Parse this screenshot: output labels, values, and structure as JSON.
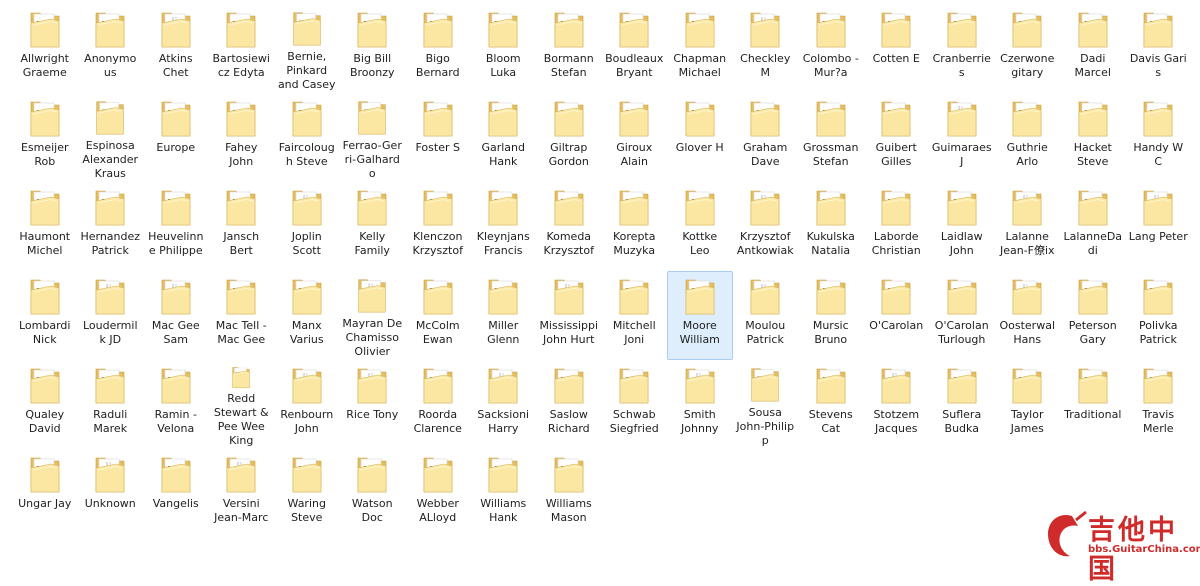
{
  "folders": [
    "Allwright\nGraeme",
    "Anonymo\nus",
    "Atkins\nChet",
    "Bartosiewi\ncz Edyta",
    "Bernie,\nPinkard\nand Casey",
    "Big Bill\nBroonzy",
    "Bigo\nBernard",
    "Bloom\nLuka",
    "Bormann\nStefan",
    "Boudleaux\nBryant",
    "Chapman\nMichael",
    "Checkley\nM",
    "Colombo -\nMur?a",
    "Cotten E",
    "Cranberrie\ns",
    "Czerwone\ngitary",
    "Dadi\nMarcel",
    "Davis Garis",
    "Esmeijer\nRob",
    "Espinosa\nAlexander\nKraus",
    "Europe",
    "Fahey\nJohn",
    "Faircoloug\nh Steve",
    "Ferrao-Ger\nri-Galhard\no",
    "Foster S",
    "Garland\nHank",
    "Giltrap\nGordon",
    "Giroux\nAlain",
    "Glover H",
    "Graham\nDave",
    "Grossman\nStefan",
    "Guibert\nGilles",
    "Guimaraes\nJ",
    "Guthrie\nArlo",
    "Hacket\nSteve",
    "Handy W\nC",
    "Haumont\nMichel",
    "Hernandez\nPatrick",
    "Heuvelinn\ne Philippe",
    "Jansch\nBert",
    "Joplin\nScott",
    "Kelly\nFamily",
    "Klenczon\nKrzysztof",
    "Kleynjans\nFrancis",
    "Komeda\nKrzysztof",
    "Korepta\nMuzyka",
    "Kottke\nLeo",
    "Krzysztof\nAntkowiak",
    "Kukulska\nNatalia",
    "Laborde\nChristian",
    "Laidlaw\nJohn",
    "Lalanne\nJean-F僚ix",
    "LalanneDa\ndi",
    "Lang Peter",
    "Lombardi\nNick",
    "Loudermil\nk JD",
    "Mac Gee\nSam",
    "Mac Tell -\nMac Gee",
    "Manx\nVarius",
    "Mayran De\nChamisso\nOlivier",
    "McColm\nEwan",
    "Miller\nGlenn",
    "Mississippi\nJohn Hurt",
    "Mitchell\nJoni",
    "Moore\nWilliam",
    "Moulou\nPatrick",
    "Mursic\nBruno",
    "O'Carolan",
    "O'Carolan\nTurlough",
    "Oosterwal\nHans",
    "Peterson\nGary",
    "Polivka\nPatrick",
    "Qualey\nDavid",
    "Raduli\nMarek",
    "Ramin -\nVelona",
    "Redd\nStewart &\nPee Wee\nKing",
    "Renbourn\nJohn",
    "Rice Tony",
    "Roorda\nClarence",
    "Sacksioni\nHarry",
    "Saslow\nRichard",
    "Schwab\nSiegfried",
    "Smith\nJohnny",
    "Sousa\nJohn-Philip\np",
    "Stevens\nCat",
    "Stotzem\nJacques",
    "Suflera\nBudka",
    "Taylor\nJames",
    "Traditional",
    "Travis\nMerle",
    "Ungar Jay",
    "Unknown",
    "Vangelis",
    "Versini\nJean-Marc",
    "Waring\nSteve",
    "Watson\nDoc",
    "Webber\nALloyd",
    "Williams\nHank",
    "Williams\nMason"
  ],
  "selected_folder_index": 64,
  "folders_with_content": [
    0,
    1,
    3,
    4,
    5,
    6,
    7,
    8,
    9,
    10,
    12,
    13,
    14,
    15,
    16,
    17,
    18,
    19,
    20,
    21,
    22,
    23,
    24,
    25,
    26,
    27,
    28,
    29,
    30,
    31,
    33,
    34,
    35,
    36,
    37,
    38,
    39,
    41,
    42,
    43,
    44,
    45,
    46,
    48,
    49,
    50,
    52,
    54,
    57,
    58,
    60,
    61,
    63,
    64,
    66,
    67,
    68,
    70,
    71,
    72,
    73,
    74,
    75,
    78,
    80,
    81,
    83,
    84,
    86,
    87,
    88,
    89,
    90,
    92,
    94,
    95,
    96,
    97,
    98,
    99
  ],
  "icons": {
    "folder": "folder-icon",
    "watermark_logo": "guitar-logo-icon"
  },
  "colors": {
    "folder_light": "#fbe7a1",
    "folder_dark": "#e6be5c",
    "selection": "#dfeefc",
    "watermark": "#d02b2b"
  },
  "watermark": {
    "main": "吉他中国",
    "url": "bbs.GuitarChina.com"
  }
}
